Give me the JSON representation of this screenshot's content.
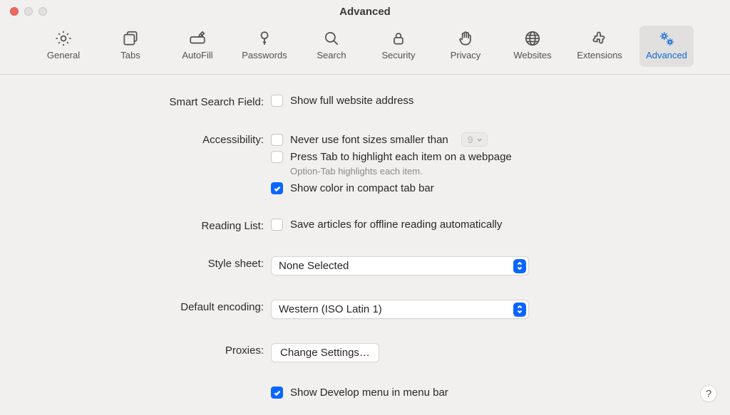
{
  "window": {
    "title": "Advanced"
  },
  "tabs": [
    {
      "label": "General"
    },
    {
      "label": "Tabs"
    },
    {
      "label": "AutoFill"
    },
    {
      "label": "Passwords"
    },
    {
      "label": "Search"
    },
    {
      "label": "Security"
    },
    {
      "label": "Privacy"
    },
    {
      "label": "Websites"
    },
    {
      "label": "Extensions"
    },
    {
      "label": "Advanced"
    }
  ],
  "sections": {
    "smart_search": {
      "label": "Smart Search Field:",
      "show_full_address": "Show full website address"
    },
    "accessibility": {
      "label": "Accessibility:",
      "never_smaller": "Never use font sizes smaller than",
      "font_size_value": "9",
      "press_tab": "Press Tab to highlight each item on a webpage",
      "hint": "Option-Tab highlights each item.",
      "show_color": "Show color in compact tab bar"
    },
    "reading_list": {
      "label": "Reading List:",
      "save_offline": "Save articles for offline reading automatically"
    },
    "style_sheet": {
      "label": "Style sheet:",
      "value": "None Selected"
    },
    "default_encoding": {
      "label": "Default encoding:",
      "value": "Western (ISO Latin 1)"
    },
    "proxies": {
      "label": "Proxies:",
      "button": "Change Settings…"
    },
    "develop": {
      "show_develop": "Show Develop menu in menu bar"
    }
  },
  "help": "?"
}
